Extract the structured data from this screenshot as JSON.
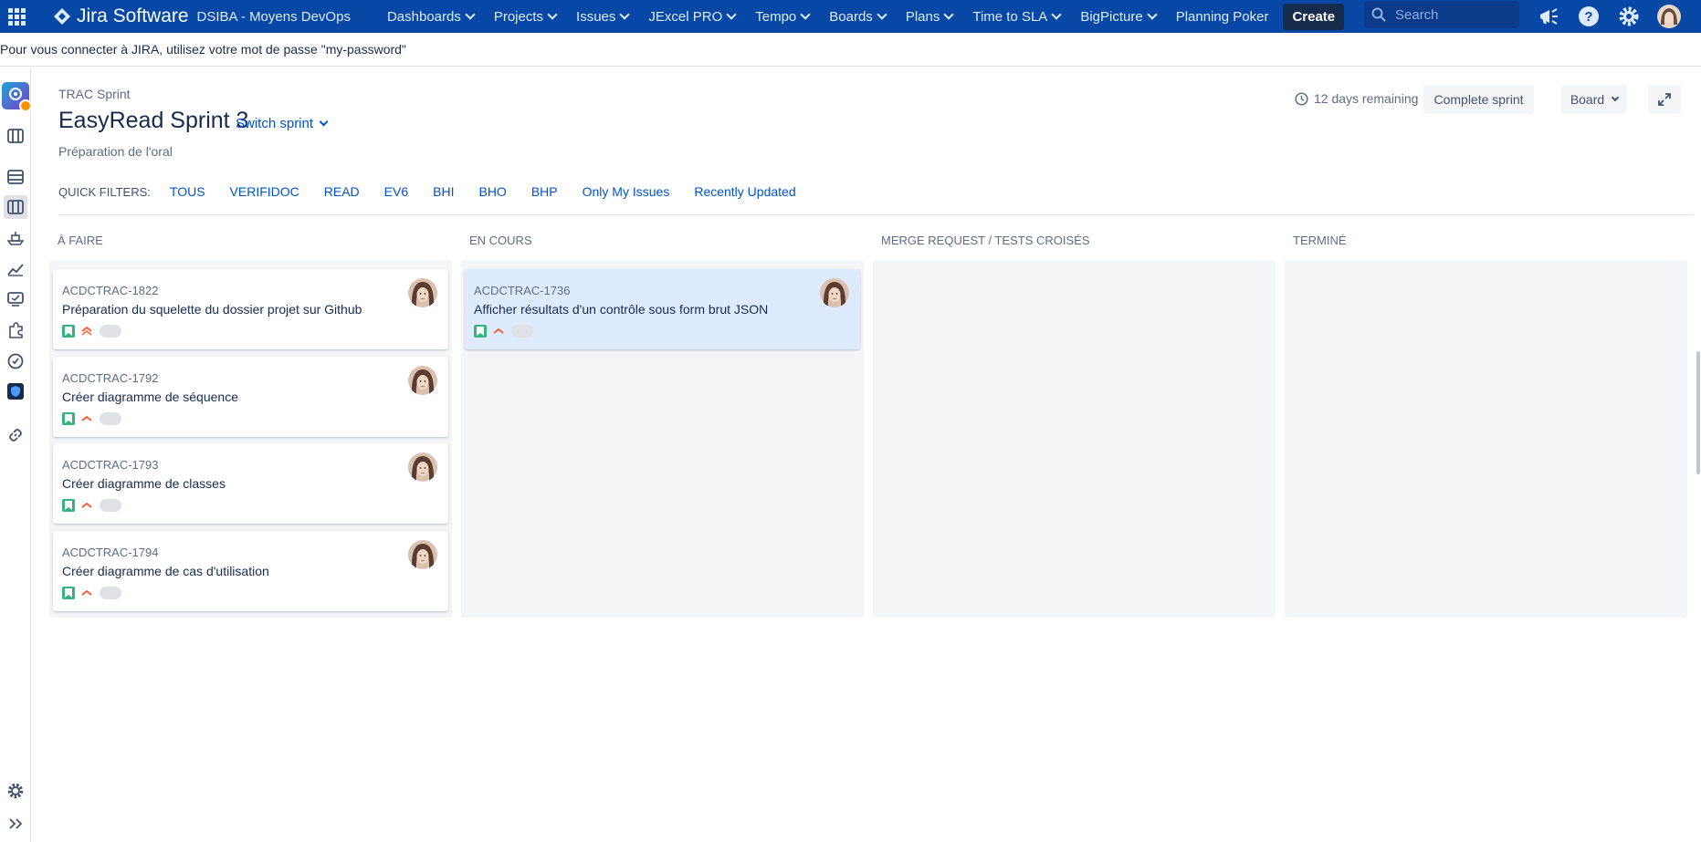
{
  "topnav": {
    "brand": "Jira Software",
    "project": "DSIBA - Moyens DevOps",
    "menus": [
      {
        "label": "Dashboards",
        "dropdown": true
      },
      {
        "label": "Projects",
        "dropdown": true
      },
      {
        "label": "Issues",
        "dropdown": true
      },
      {
        "label": "JExcel PRO",
        "dropdown": true
      },
      {
        "label": "Tempo",
        "dropdown": true
      },
      {
        "label": "Boards",
        "dropdown": true
      },
      {
        "label": "Plans",
        "dropdown": true
      },
      {
        "label": "Time to SLA",
        "dropdown": true
      },
      {
        "label": "BigPicture",
        "dropdown": true
      },
      {
        "label": "Planning Poker",
        "dropdown": false
      }
    ],
    "create_label": "Create",
    "search_placeholder": "Search",
    "colors": {
      "bar": "#0747a6",
      "create_bg": "#172b4d"
    }
  },
  "announcement": "Pour vous connecter à JIRA, utilisez votre mot de passe \"my-password\"",
  "header": {
    "sprint_label": "TRAC Sprint",
    "sprint_title": "EasyRead Sprint 3",
    "switch_label": "Switch sprint",
    "goal": "Préparation de l'oral",
    "remaining": "12 days remaining",
    "complete_label": "Complete sprint",
    "board_label": "Board"
  },
  "filters": {
    "label": "QUICK FILTERS:",
    "items": [
      "TOUS",
      "VERIFIDOC",
      "READ",
      "EV6",
      "BHI",
      "BHO",
      "BHP",
      "Only My Issues",
      "Recently Updated"
    ]
  },
  "columns": [
    {
      "title": "À FAIRE",
      "cards": [
        {
          "key": "ACDCTRAC-1822",
          "summary": "Préparation du squelette du dossier projet sur Github",
          "priority": "high",
          "selected": false
        },
        {
          "key": "ACDCTRAC-1792",
          "summary": "Créer diagramme de séquence",
          "priority": "medium",
          "selected": false
        },
        {
          "key": "ACDCTRAC-1793",
          "summary": "Créer diagramme de classes",
          "priority": "medium",
          "selected": false
        },
        {
          "key": "ACDCTRAC-1794",
          "summary": "Créer diagramme de cas d'utilisation",
          "priority": "medium",
          "selected": false
        }
      ]
    },
    {
      "title": "EN COURS",
      "cards": [
        {
          "key": "ACDCTRAC-1736",
          "summary": "Afficher résultats d'un contrôle sous form brut JSON",
          "priority": "medium",
          "selected": true
        }
      ]
    },
    {
      "title": "MERGE REQUEST / TESTS CROISÉS",
      "cards": []
    },
    {
      "title": "TERMINÉ",
      "cards": []
    }
  ],
  "icons": {
    "story": "story-icon",
    "priority_high": "priority-high-icon",
    "priority_medium": "priority-medium-icon"
  }
}
